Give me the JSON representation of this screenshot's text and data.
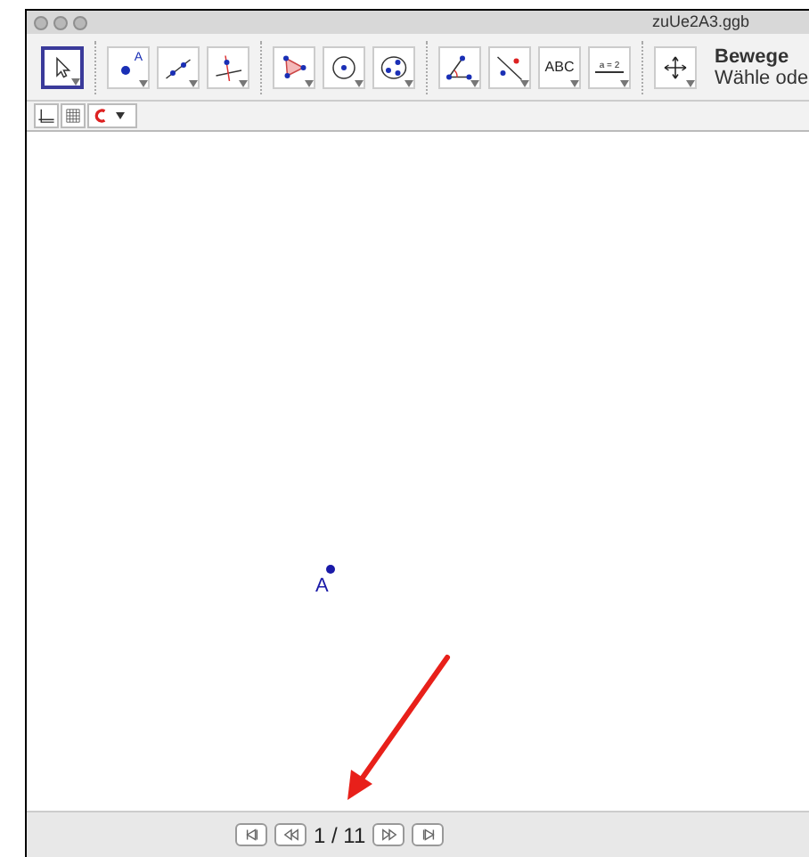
{
  "window": {
    "title": "zuUe2A3.ggb"
  },
  "toolbar": {
    "groups": [
      [
        {
          "kind": "select",
          "selected": true
        }
      ],
      [
        {
          "kind": "point",
          "label": "A",
          "selected": false
        },
        {
          "kind": "line",
          "selected": false
        },
        {
          "kind": "perpendicular",
          "selected": false
        }
      ],
      [
        {
          "kind": "polygon",
          "selected": false
        },
        {
          "kind": "circle",
          "selected": false
        },
        {
          "kind": "circle3",
          "selected": false
        }
      ],
      [
        {
          "kind": "angle",
          "selected": false
        },
        {
          "kind": "reflect",
          "selected": false
        },
        {
          "kind": "text",
          "label": "ABC",
          "selected": false
        },
        {
          "kind": "slider",
          "label": "a = 2",
          "selected": false
        }
      ],
      [
        {
          "kind": "move",
          "selected": false
        }
      ]
    ],
    "tool_name": "Bewege",
    "tool_help": "Wähle ode"
  },
  "style_bar": [
    {
      "kind": "axes"
    },
    {
      "kind": "grid"
    },
    {
      "kind": "capture"
    }
  ],
  "canvas": {
    "points": [
      {
        "label": "A"
      }
    ]
  },
  "navigation": {
    "buttons": [
      {
        "kind": "first"
      },
      {
        "kind": "previous"
      },
      {
        "kind": "page",
        "label": "1 / 11"
      },
      {
        "kind": "next"
      },
      {
        "kind": "last"
      }
    ]
  }
}
